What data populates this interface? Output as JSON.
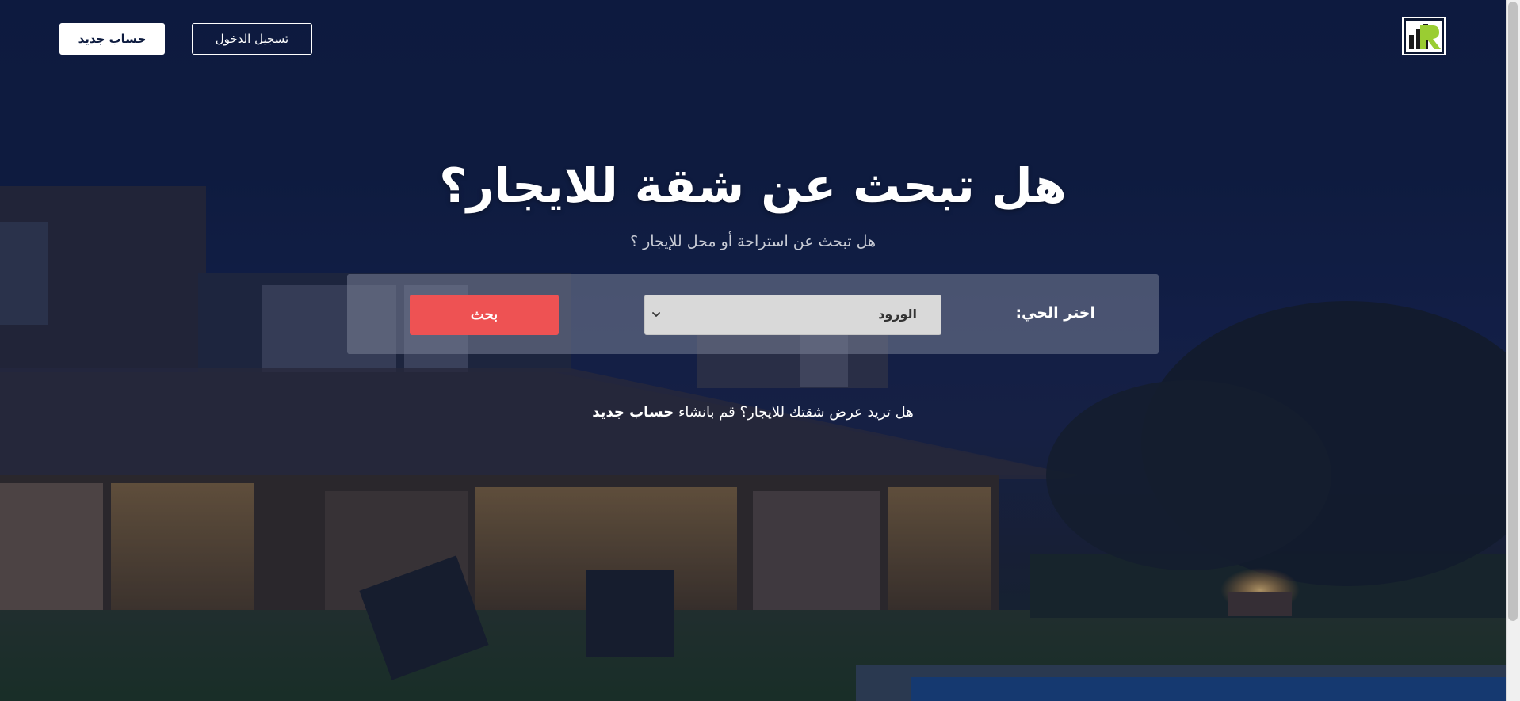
{
  "header": {
    "login_label": "تسجيل الدخول",
    "signup_label": "حساب جديد"
  },
  "hero": {
    "title": "هل تبحث عن شقة للايجار؟",
    "subtitle": "هل تبحث عن استراحة أو محل للإيجار ؟"
  },
  "search": {
    "district_label": "اختر الحي:",
    "selected_district": "الورود",
    "button_label": "بحث"
  },
  "cta": {
    "text": "هل تريد عرض شقتك للايجار؟ قم بانشاء",
    "link_label": "حساب جديد"
  },
  "colors": {
    "search_button": "#ee5253",
    "overlay": "#0d1b3f",
    "logo_accent": "#9acd32"
  },
  "icons": [
    "logo-icon",
    "chevron-down-icon"
  ]
}
